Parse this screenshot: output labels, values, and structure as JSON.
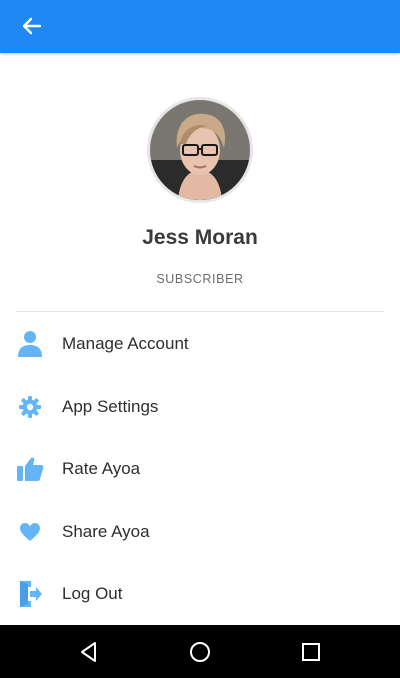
{
  "app_bar": {
    "back_icon": "arrow-left-icon",
    "color": "#1e88f5"
  },
  "profile": {
    "avatar_icon": "user-photo-avatar",
    "name": "Jess Moran",
    "role": "SUBSCRIBER"
  },
  "menu": {
    "icon_color": "#64b5f6",
    "items": [
      {
        "label": "Manage Account",
        "icon": "person-icon"
      },
      {
        "label": "App Settings",
        "icon": "gear-icon"
      },
      {
        "label": "Rate Ayoa",
        "icon": "thumbs-up-icon"
      },
      {
        "label": "Share Ayoa",
        "icon": "heart-icon"
      },
      {
        "label": "Log Out",
        "icon": "logout-icon"
      }
    ]
  },
  "system_nav": {
    "back": "triangle-back-icon",
    "home": "circle-home-icon",
    "recents": "square-recents-icon"
  }
}
